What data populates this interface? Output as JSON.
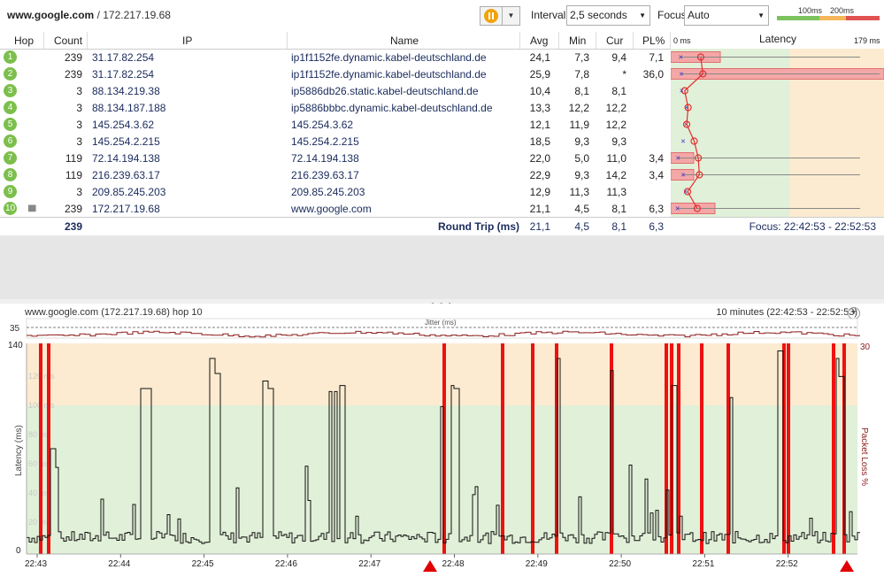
{
  "toolbar": {
    "target_host": "www.google.com",
    "target_ip": " / 172.217.19.68",
    "interval_label": "Interval",
    "interval_value": "2,5 seconds",
    "focus_label": "Focus",
    "focus_value": "Auto",
    "legend_100": "100ms",
    "legend_200": "200ms",
    "colors": {
      "green": "#7cc35e",
      "orange": "#f5b75a",
      "red": "#e05252"
    }
  },
  "table": {
    "headers": {
      "hop": "Hop",
      "count": "Count",
      "ip": "IP",
      "name": "Name",
      "avg": "Avg",
      "min": "Min",
      "cur": "Cur",
      "pl": "PL%",
      "latency": "Latency",
      "lat_min": "0 ms",
      "lat_max": "179 ms"
    },
    "rows": [
      {
        "hop": "1",
        "count": "239",
        "ip": "31.17.82.254",
        "name": "ip1f1152fe.dynamic.kabel-deutschland.de",
        "avg": "24,1",
        "min": "7,3",
        "cur": "9,4",
        "pl": "7,1"
      },
      {
        "hop": "2",
        "count": "239",
        "ip": "31.17.82.254",
        "name": "ip1f1152fe.dynamic.kabel-deutschland.de",
        "avg": "25,9",
        "min": "7,8",
        "cur": "*",
        "pl": "36,0"
      },
      {
        "hop": "3",
        "count": "3",
        "ip": "88.134.219.38",
        "name": "ip5886db26.static.kabel-deutschland.de",
        "avg": "10,4",
        "min": "8,1",
        "cur": "8,1",
        "pl": ""
      },
      {
        "hop": "4",
        "count": "3",
        "ip": "88.134.187.188",
        "name": "ip5886bbbc.dynamic.kabel-deutschland.de",
        "avg": "13,3",
        "min": "12,2",
        "cur": "12,2",
        "pl": ""
      },
      {
        "hop": "5",
        "count": "3",
        "ip": "145.254.3.62",
        "name": "145.254.3.62",
        "avg": "12,1",
        "min": "11,9",
        "cur": "12,2",
        "pl": ""
      },
      {
        "hop": "6",
        "count": "3",
        "ip": "145.254.2.215",
        "name": "145.254.2.215",
        "avg": "18,5",
        "min": "9,3",
        "cur": "9,3",
        "pl": ""
      },
      {
        "hop": "7",
        "count": "119",
        "ip": "72.14.194.138",
        "name": "72.14.194.138",
        "avg": "22,0",
        "min": "5,0",
        "cur": "11,0",
        "pl": "3,4"
      },
      {
        "hop": "8",
        "count": "119",
        "ip": "216.239.63.17",
        "name": "216.239.63.17",
        "avg": "22,9",
        "min": "9,3",
        "cur": "14,2",
        "pl": "3,4"
      },
      {
        "hop": "9",
        "count": "3",
        "ip": "209.85.245.203",
        "name": "209.85.245.203",
        "avg": "12,9",
        "min": "11,3",
        "cur": "11,3",
        "pl": ""
      },
      {
        "hop": "10",
        "count": "239",
        "ip": "172.217.19.68",
        "name": "www.google.com",
        "avg": "21,1",
        "min": "4,5",
        "cur": "8,1",
        "pl": "6,3"
      }
    ],
    "summary": {
      "count": "239",
      "label": "Round Trip (ms)",
      "avg": "21,1",
      "min": "4,5",
      "cur": "8,1",
      "pl": "6,3",
      "focus": "Focus: 22:42:53 - 22:52:53"
    }
  },
  "graph": {
    "title": "www.google.com (172.217.19.68) hop 10",
    "range": "10 minutes (22:42:53 - 22:52:53)",
    "jitter_label": "Jitter (ms)",
    "jitter_max": "35",
    "y_label": "Latency (ms)",
    "y2_label": "Packet Loss %",
    "y_max": "140",
    "y_zero": "0",
    "y2_max": "30",
    "grid_labels": [
      "120 ms",
      "100 ms",
      "80 ms",
      "60 ms",
      "40 ms",
      "20 ms"
    ],
    "x_ticks": [
      "22:43",
      "22:44",
      "22:45",
      "22:46",
      "22:47",
      "22:48",
      "22:49",
      "22:50",
      "22:51",
      "22:52"
    ]
  },
  "chart_data": {
    "type": "line",
    "title": "www.google.com (172.217.19.68) hop 10",
    "xlabel": "",
    "ylabel": "Latency (ms)",
    "ylim": [
      0,
      140
    ],
    "y2label": "Packet Loss %",
    "x": [
      "22:43",
      "22:44",
      "22:45",
      "22:46",
      "22:47",
      "22:48",
      "22:49",
      "22:50",
      "22:51",
      "22:52"
    ],
    "latency_spikes_ms": [
      70,
      110,
      130,
      120,
      115,
      108,
      112,
      98,
      112,
      130,
      122,
      112,
      104,
      135,
      130,
      118
    ],
    "packet_loss_markers_time": [
      "22:43",
      "22:48",
      "22:49",
      "22:50",
      "22:51",
      "22:52"
    ],
    "grid": true
  }
}
